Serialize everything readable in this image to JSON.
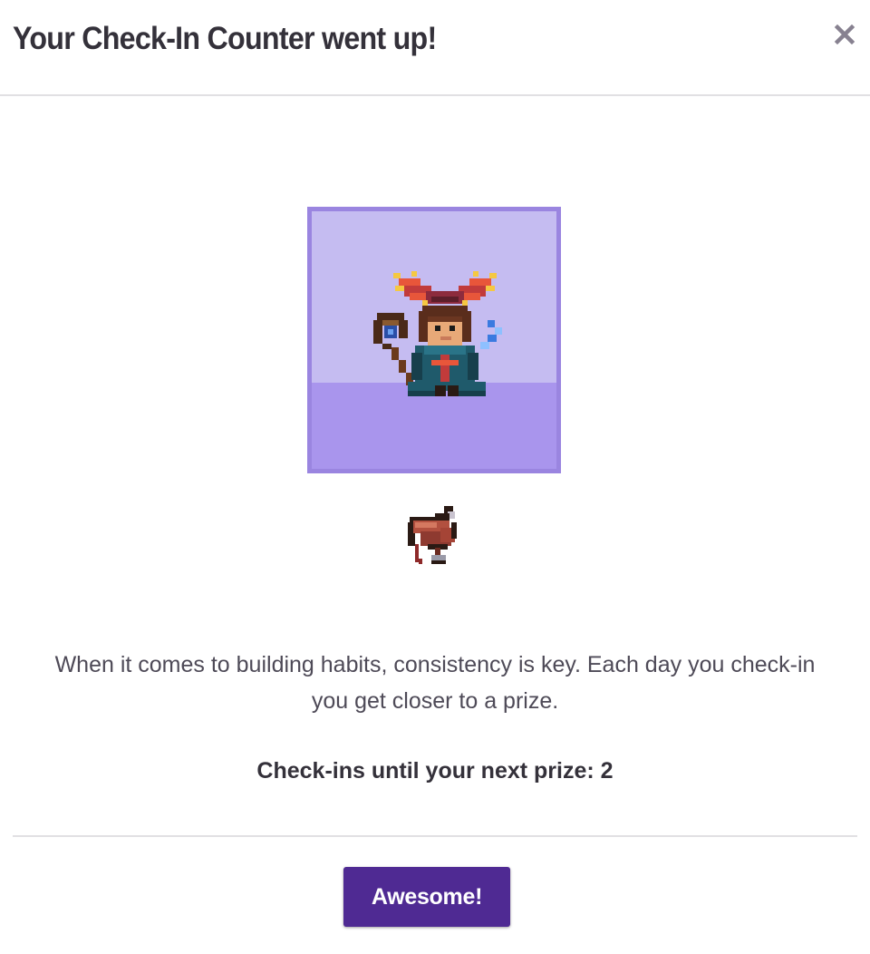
{
  "modal": {
    "title": "Your Check-In Counter went up!",
    "close_icon": "close-icon"
  },
  "avatar": {
    "icon": "wizard-avatar-sprite",
    "background_color": "#c5bcf1",
    "floor_color": "#a995ed",
    "border_color": "#9a85e0"
  },
  "prize": {
    "icon": "saddle-icon"
  },
  "body": {
    "text": "When it comes to building habits, consistency is key. Each day you check-in you get closer to a prize.",
    "counter_text": "Check-ins until your next prize: 2"
  },
  "footer": {
    "button_label": "Awesome!",
    "button_color": "#4f2a93"
  }
}
